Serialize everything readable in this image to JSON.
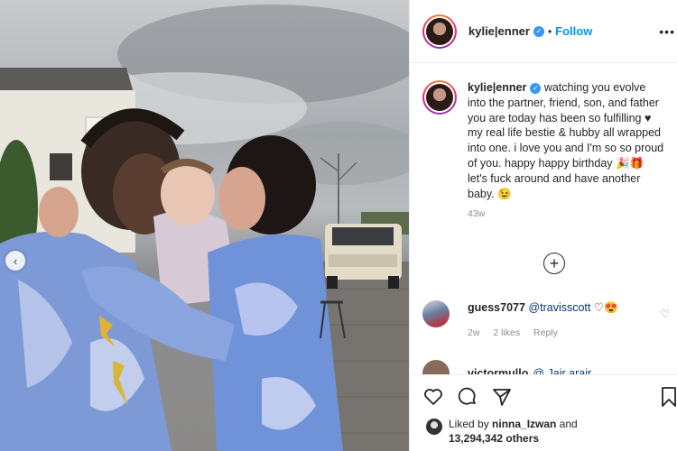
{
  "post": {
    "username": "kylie|enner",
    "follow_label": "Follow",
    "separator": "•",
    "more_label": "•••"
  },
  "caption": {
    "username": "kylie|enner",
    "text": " watching you evolve into the partner, friend, son, and father you are today has been so fulfilling ♥ my real life bestie & hubby all wrapped into one. i love you and I'm so so proud of you. happy happy birthday 🎉🎁 let's fuck around and have another baby. 😉",
    "time": "43w"
  },
  "comments": [
    {
      "username": "guess7077",
      "mention": "@travisscott",
      "emoji": "♡😍",
      "time": "2w",
      "likes": "2 likes",
      "reply": "Reply"
    },
    {
      "username": "victormullo",
      "text": "@ Jair arair"
    }
  ],
  "likes": {
    "prefix": "Liked by ",
    "user": "ninna_Izwan",
    "suffix": " and",
    "count_line": "13,294,342 others"
  },
  "icons": {
    "verified": "verified-badge-icon",
    "load_more": "plus-circle-icon",
    "like": "heart-icon",
    "comment": "comment-icon",
    "share": "paper-plane-icon",
    "save": "bookmark-icon",
    "prev": "chevron-left-icon"
  },
  "colors": {
    "follow": "#0095f6",
    "verified": "#3897f0",
    "meta": "#8e8e8e"
  }
}
